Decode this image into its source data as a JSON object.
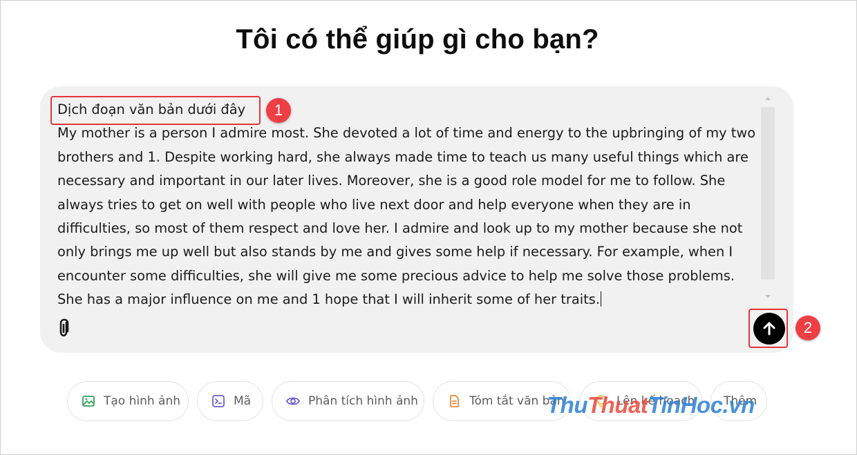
{
  "heading": "Tôi có thể giúp gì cho bạn?",
  "composer": {
    "first_line": "Dịch đoạn văn bản dưới đây",
    "body": "My mother is a person I admire most. She devoted a lot of time and energy to the upbringing of my two brothers and 1. Despite working hard, she always made time to teach us many useful things which are necessary and important in our later lives. Moreover, she is a good role model for me to follow. She always tries to get on well with people who live next door and help everyone when they are in difficulties, so most of them respect and love her. I admire and look up to my mother because she not only brings me up well but also stands by me and gives some help if necessary. For example, when I encounter some difficulties, she will give me some precious advice to help me solve those problems. She has a major influence on me and 1 hope that I will inherit some of her traits.",
    "attach_icon": "paperclip-icon",
    "send_icon": "arrow-up-icon"
  },
  "annotations": {
    "marker_1": "1",
    "marker_2": "2",
    "color": "#e5343b"
  },
  "chips": [
    {
      "label": "Tạo hình ảnh",
      "icon": "image-icon",
      "color": "#2ea15a"
    },
    {
      "label": "Mã",
      "icon": "code-terminal-icon",
      "color": "#6b5fd6"
    },
    {
      "label": "Phân tích hình ảnh",
      "icon": "eye-icon",
      "color": "#6b5fd6"
    },
    {
      "label": "Tóm tắt văn bản",
      "icon": "document-icon",
      "color": "#e8893a"
    },
    {
      "label": "Lên kế hoạch",
      "icon": "lightbulb-icon",
      "color": "#e8c23a"
    },
    {
      "label": "Thêm",
      "icon": "",
      "color": "#5d5d5d"
    }
  ],
  "watermark": {
    "part1": "Thu",
    "part2": "Thuat",
    "part3": "TinHoc",
    "part4": ".vn"
  }
}
